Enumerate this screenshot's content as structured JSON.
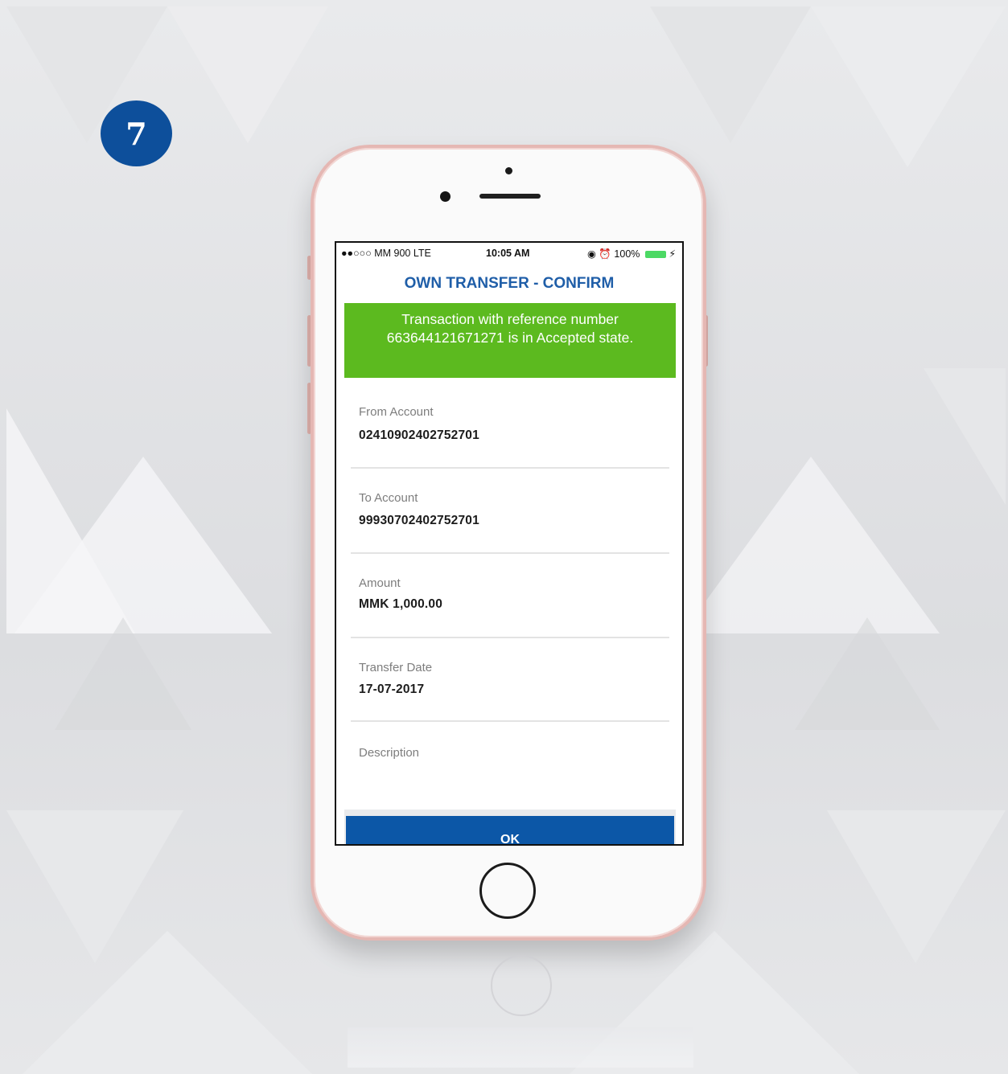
{
  "step_number": "7",
  "status_bar": {
    "carrier": "●●○○○ MM 900  LTE",
    "time": "10:05 AM",
    "right": "◉ ⏰ 100%",
    "charging": "⚡"
  },
  "screen": {
    "title": "OWN TRANSFER - CONFIRM",
    "banner_line1": "Transaction with reference  number",
    "banner_line2": "663644121671271 is in Accepted state.",
    "fields": [
      {
        "label": "From Account",
        "value": "02410902402752701"
      },
      {
        "label": "To Account",
        "value": "99930702402752701"
      },
      {
        "label": "Amount",
        "value": "MMK 1,000.00"
      },
      {
        "label": "Transfer Date",
        "value": "17-07-2017"
      },
      {
        "label": "Description",
        "value": ""
      }
    ],
    "ok_label": "OK"
  },
  "colors": {
    "badge": "#0d4f9b",
    "title": "#1f5ea8",
    "banner": "#5cba1f",
    "button": "#0c57a7",
    "phone_frame": "#e5b7b3"
  }
}
